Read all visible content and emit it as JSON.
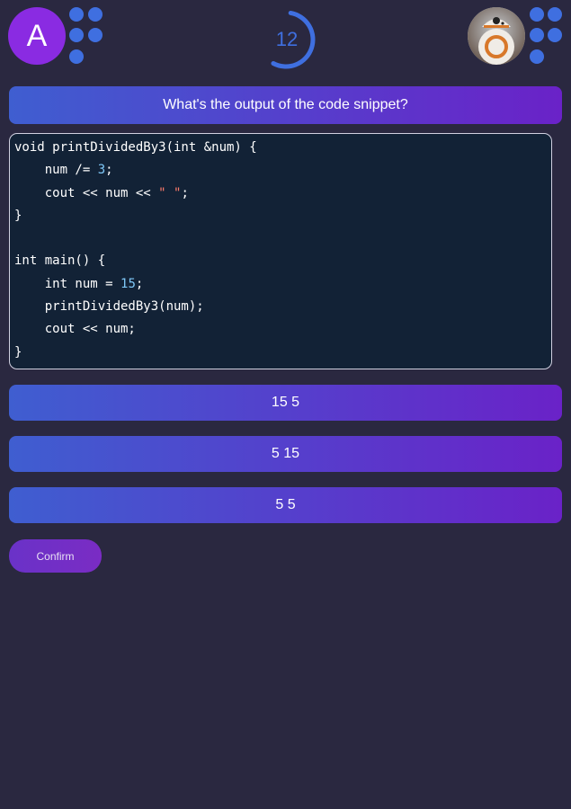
{
  "player": {
    "initial": "A"
  },
  "timer": {
    "seconds": "12",
    "remaining_fraction": 0.55
  },
  "question": {
    "text": "What's the output of the code snippet?"
  },
  "code": {
    "lines": [
      [
        {
          "t": "void printDividedBy3(int &num) {",
          "c": "plain"
        }
      ],
      [
        {
          "t": "    num /= ",
          "c": "plain"
        },
        {
          "t": "3",
          "c": "num"
        },
        {
          "t": ";",
          "c": "plain"
        }
      ],
      [
        {
          "t": "    cout << num << ",
          "c": "plain"
        },
        {
          "t": "\" \"",
          "c": "str"
        },
        {
          "t": ";",
          "c": "plain"
        }
      ],
      [
        {
          "t": "}",
          "c": "plain"
        }
      ],
      [
        {
          "t": "",
          "c": "plain"
        }
      ],
      [
        {
          "t": "int main() {",
          "c": "plain"
        }
      ],
      [
        {
          "t": "    int num = ",
          "c": "plain"
        },
        {
          "t": "15",
          "c": "num"
        },
        {
          "t": ";",
          "c": "plain"
        }
      ],
      [
        {
          "t": "    printDividedBy3(num);",
          "c": "plain"
        }
      ],
      [
        {
          "t": "    cout << num;",
          "c": "plain"
        }
      ],
      [
        {
          "t": "}",
          "c": "plain"
        }
      ]
    ]
  },
  "options": [
    {
      "label": "15 5"
    },
    {
      "label": "5 15"
    },
    {
      "label": "5 5"
    }
  ],
  "confirm": {
    "label": "Confirm"
  },
  "colors": {
    "accent": "#3f6fe0",
    "background": "#2a2840",
    "code_bg": "#122236"
  }
}
